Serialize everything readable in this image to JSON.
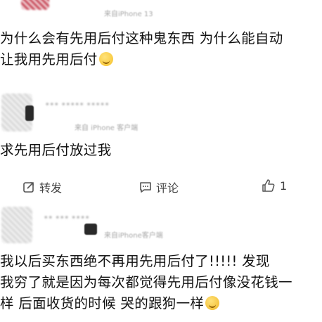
{
  "post1": {
    "meta": "来自iPhone 13",
    "text_line1": "为什么会有先用后付这种鬼东西  为什么能自动",
    "text_line2": "让我用先用后付",
    "emoji": "smile-emoji"
  },
  "post2": {
    "meta": "来自 iPhone 客户端",
    "text": "求先用后付放过我",
    "actions": {
      "repost_label": "转发",
      "comment_label": "评论",
      "like_count": "1"
    }
  },
  "post3": {
    "meta": "来自iPhone客户端",
    "text_line1": "我以后买东西绝不再用先用后付了!!!!!  发现",
    "text_line2": "我穷了就是因为每次都觉得先用后付像没花钱一",
    "text_line3": "样  后面收货的时候  哭的跟狗一样",
    "emoji": "crying-emoji"
  }
}
